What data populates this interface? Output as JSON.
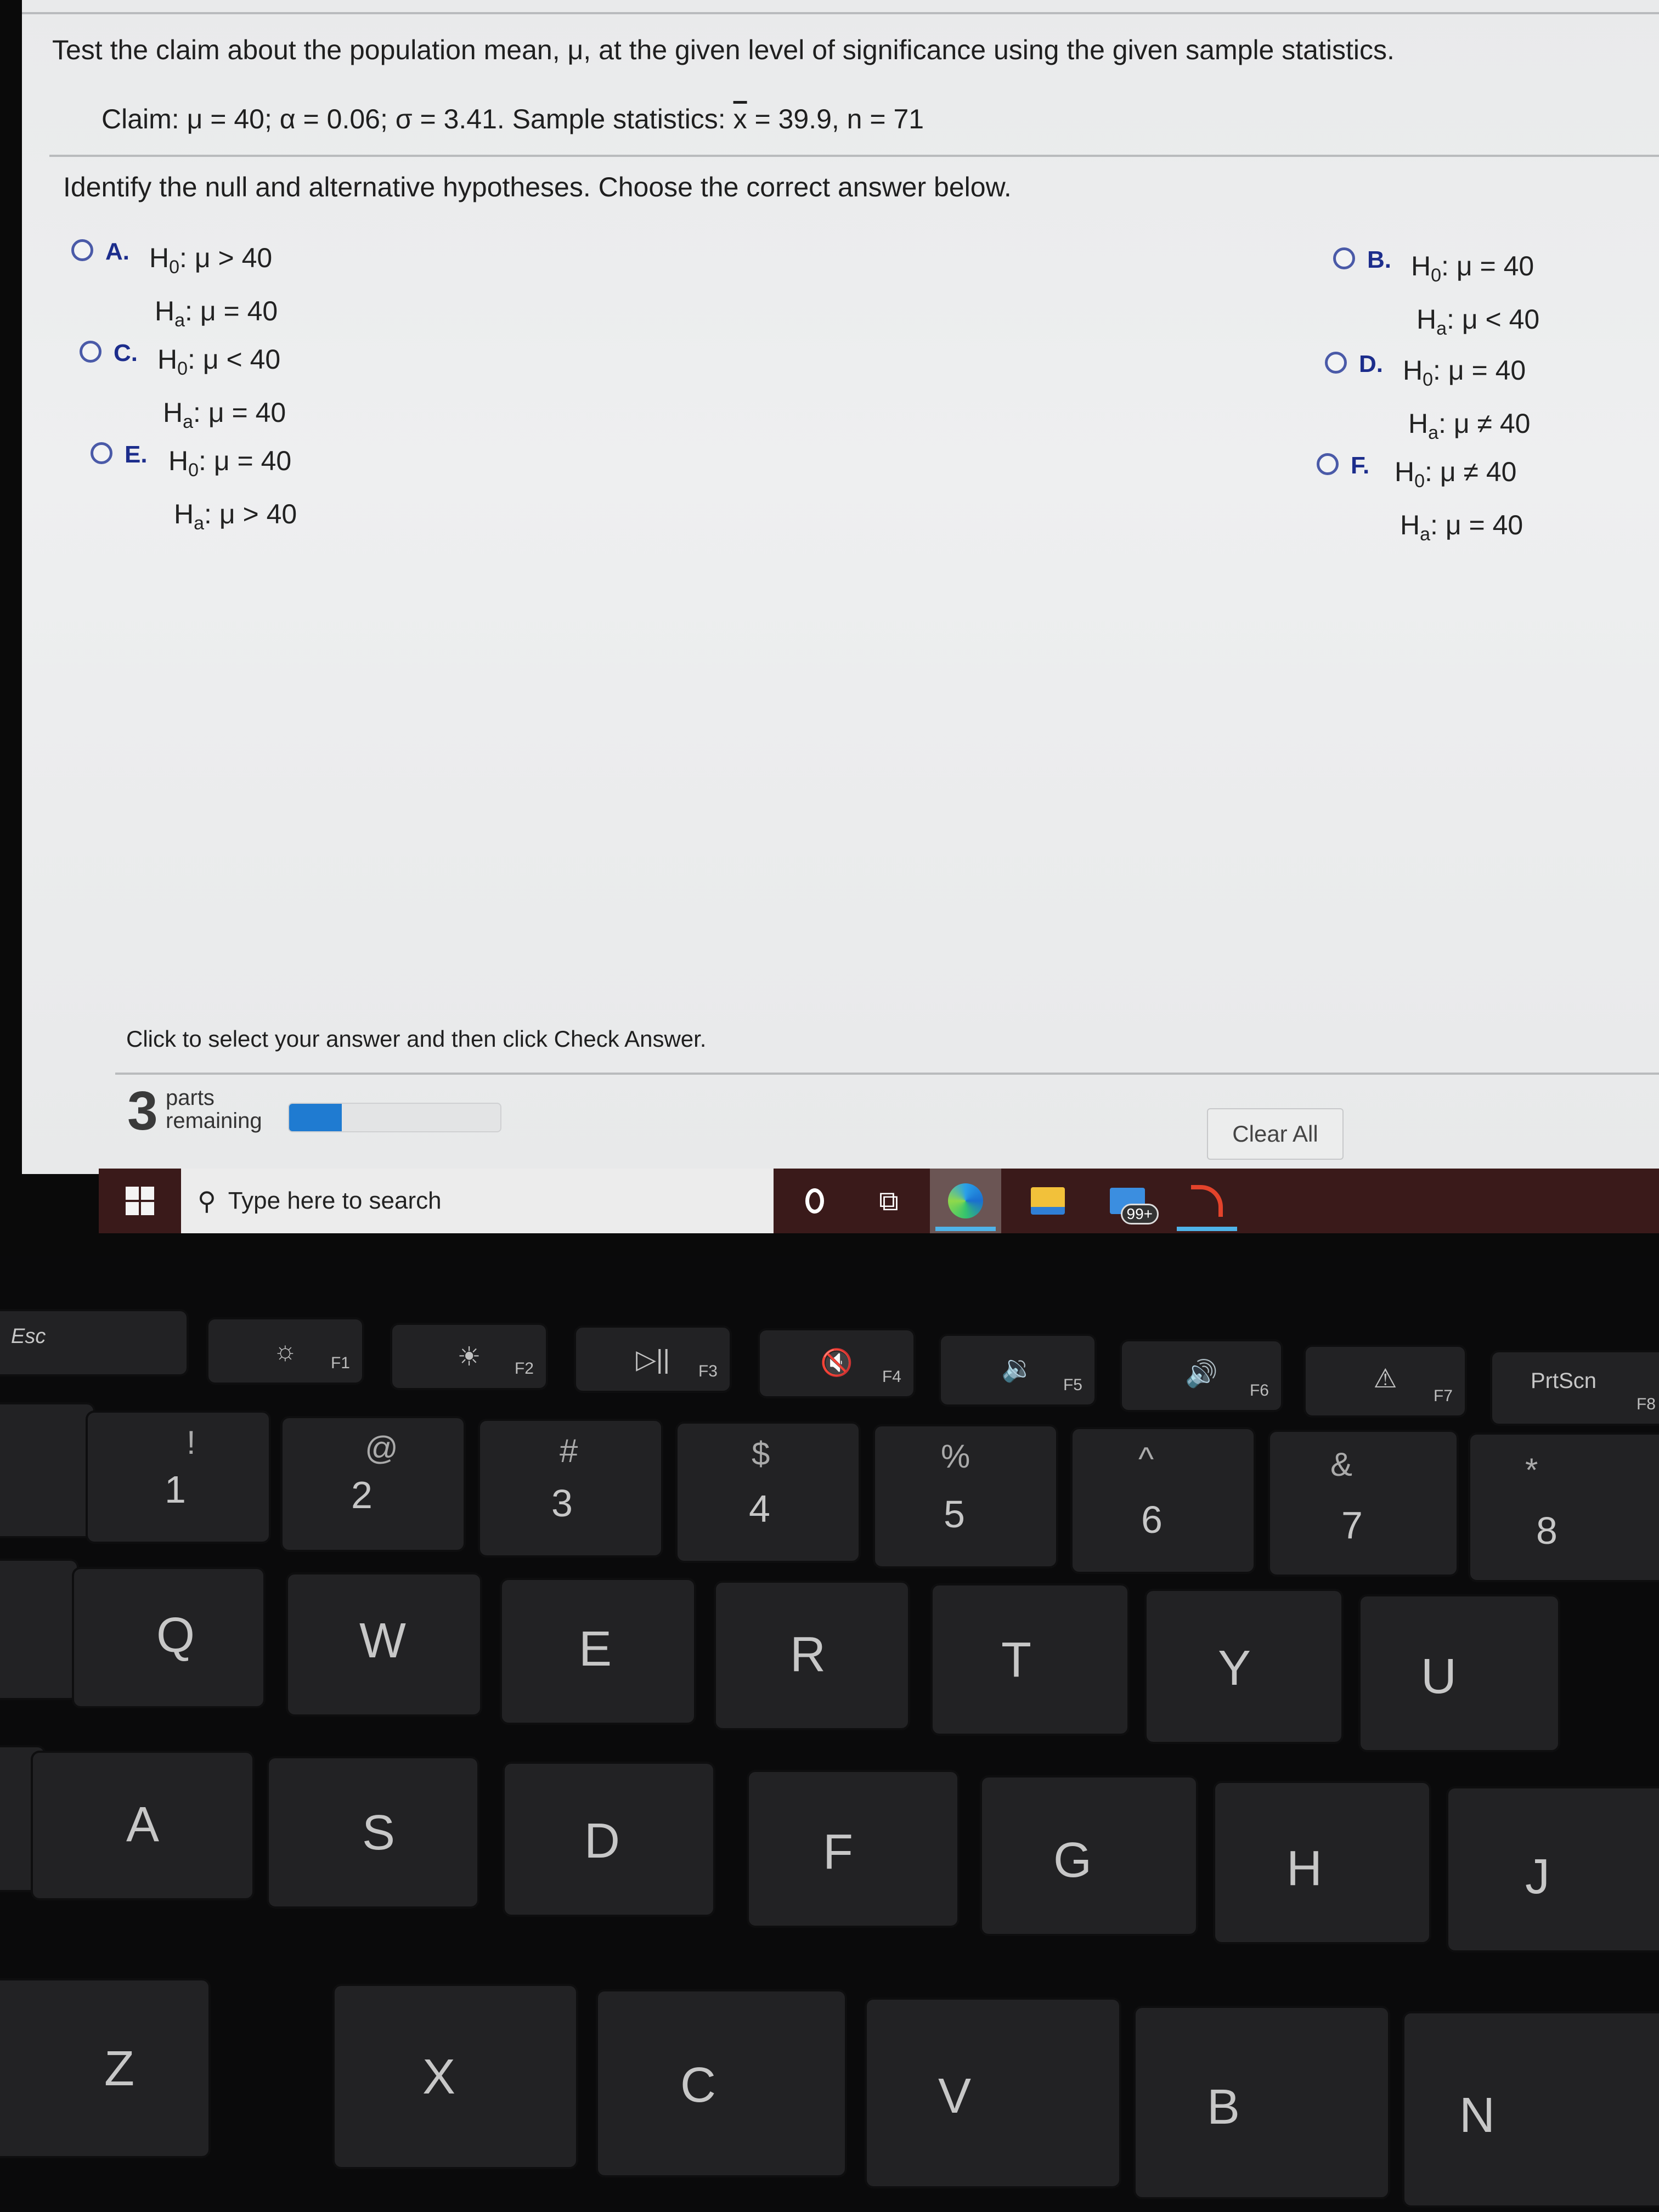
{
  "question": {
    "prompt": "Test the claim about the population mean, μ, at the given level of significance using the given sample statistics.",
    "claim_prefix": "Claim: μ = 40; α = 0.06; σ = 3.41. Sample statistics: ",
    "xbar_symbol": "x",
    "claim_suffix": " = 39.9, n = 71",
    "instruction": "Identify the null and alternative hypotheses. Choose the correct answer below."
  },
  "options": [
    {
      "letter": "A.",
      "h0_rel": ": μ > 40",
      "ha_rel": ": μ = 40"
    },
    {
      "letter": "B.",
      "h0_rel": ": μ = 40",
      "ha_rel": ": μ < 40"
    },
    {
      "letter": "C.",
      "h0_rel": ": μ < 40",
      "ha_rel": ": μ = 40"
    },
    {
      "letter": "D.",
      "h0_rel": ": μ = 40",
      "ha_rel": ": μ ≠ 40"
    },
    {
      "letter": "E.",
      "h0_rel": ": μ = 40",
      "ha_rel": ": μ > 40"
    },
    {
      "letter": "F.",
      "h0_rel": ": μ ≠ 40",
      "ha_rel": ": μ = 40"
    }
  ],
  "hyp_labels": {
    "h": "H",
    "null_sub": "0",
    "alt_sub": "a"
  },
  "footer": {
    "click_text": "Click to select your answer and then click Check Answer.",
    "parts_count": "3",
    "parts_label_1": "parts",
    "parts_label_2": "remaining",
    "progress_percent": 25,
    "progress_color": "#1f7bd1",
    "clear_all": "Clear All"
  },
  "taskbar": {
    "search_placeholder": "Type here to search",
    "mail_badge": "99+",
    "icons": [
      "windows-start-icon",
      "search-icon",
      "cortana-icon",
      "task-view-icon",
      "edge-icon",
      "file-explorer-icon",
      "mail-icon",
      "app-icon"
    ]
  },
  "keyboard": {
    "fn_row": [
      {
        "label": "Esc"
      },
      {
        "icon": "☼",
        "fn": "F1"
      },
      {
        "icon": "☀",
        "fn": "F2"
      },
      {
        "icon": "▷||",
        "fn": "F3"
      },
      {
        "icon": "🔇",
        "fn": "F4"
      },
      {
        "icon": "🔉",
        "fn": "F5"
      },
      {
        "icon": "🔊",
        "fn": "F6"
      },
      {
        "icon": "⚠",
        "fn": "F7"
      },
      {
        "label": "PrtScn",
        "fn": "F8"
      }
    ],
    "num_row": [
      {
        "top": "!",
        "main": "1"
      },
      {
        "top": "@",
        "main": "2"
      },
      {
        "top": "#",
        "main": "3"
      },
      {
        "top": "$",
        "main": "4"
      },
      {
        "top": "%",
        "main": "5"
      },
      {
        "top": "^",
        "main": "6"
      },
      {
        "top": "&",
        "main": "7"
      },
      {
        "top": "*",
        "main": "8"
      }
    ],
    "row_q": [
      "Q",
      "W",
      "E",
      "R",
      "T",
      "Y",
      "U"
    ],
    "row_a": [
      "A",
      "S",
      "D",
      "F",
      "G",
      "H",
      "J"
    ],
    "row_z": [
      "Z",
      "X",
      "C",
      "V",
      "B",
      "N"
    ]
  }
}
